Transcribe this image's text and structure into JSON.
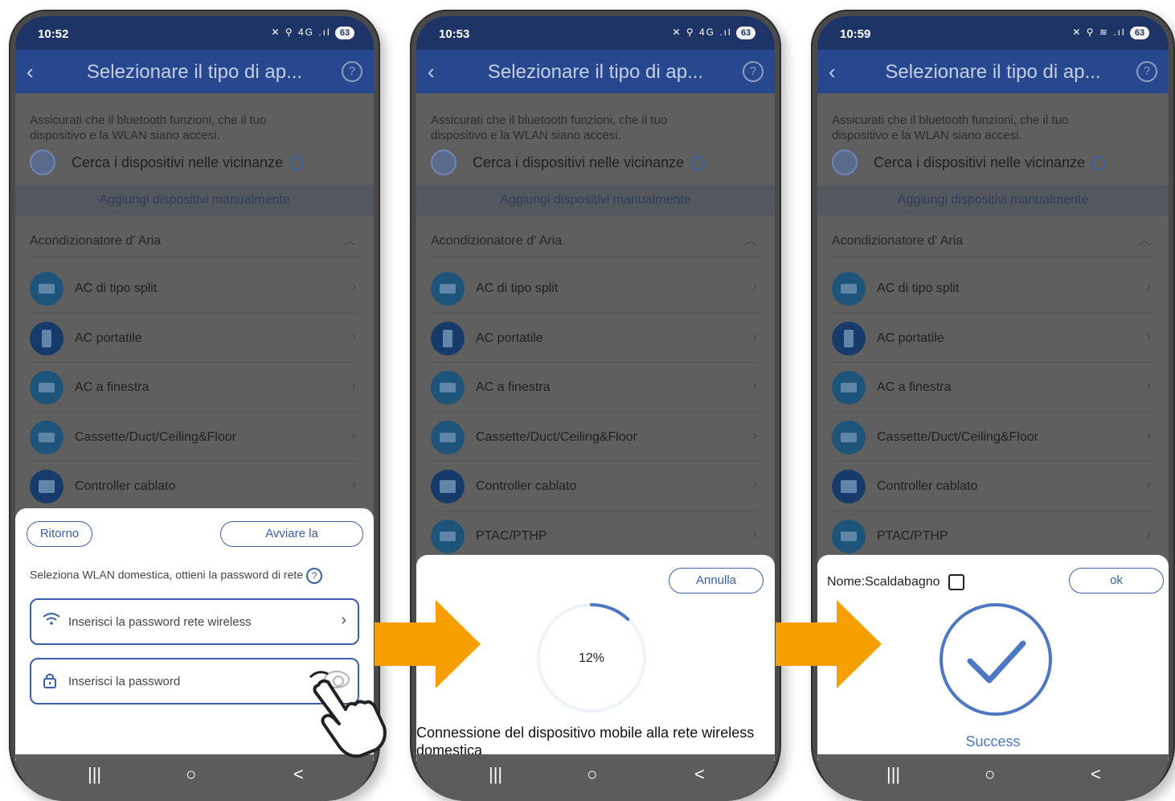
{
  "colors": {
    "accent": "#3b5fa8",
    "header": "#27488e",
    "statusbar": "#1e3467",
    "orange": "#f5a000",
    "success": "#4b77c5"
  },
  "common": {
    "title": "Selezionare il tipo di ap...",
    "info_text": "Assicurati che il bluetooth funzioni, che il tuo dispositivo e la WLAN siano accesi.",
    "search_label": "Cerca i dispositivi nelle vicinanze",
    "manual_label": "Aggiungi dispositivi manualmente",
    "section": "Acondizionatore d' Aria",
    "help_glyph": "?",
    "info_glyph": "!",
    "nav": {
      "recent": "|||",
      "home": "○",
      "back": "<"
    }
  },
  "screens": [
    {
      "time": "10:52",
      "status_icons": "✕ ⚲ 4G .ıl",
      "battery": "63",
      "items": [
        {
          "label": "AC di tipo split",
          "icon": "split-ac-icon"
        },
        {
          "label": "AC portatile",
          "icon": "portable-ac-icon"
        },
        {
          "label": "AC a finestra",
          "icon": "window-ac-icon"
        },
        {
          "label": "Cassette/Duct/Ceiling&Floor",
          "icon": "cassette-icon"
        },
        {
          "label": "Controller cablato",
          "icon": "controller-icon"
        }
      ],
      "sheet": {
        "back_button": "Ritorno",
        "start_button": "Avviare la",
        "wlan_hint": "Seleziona WLAN domestica, ottieni la password di rete",
        "wifi_placeholder": "Inserisci la password rete wireless",
        "password_placeholder": "Inserisci la password"
      }
    },
    {
      "time": "10:53",
      "status_icons": "✕ ⚲ 4G .ıl",
      "battery": "63",
      "items": [
        {
          "label": "AC di tipo split",
          "icon": "split-ac-icon"
        },
        {
          "label": "AC portatile",
          "icon": "portable-ac-icon"
        },
        {
          "label": "AC a finestra",
          "icon": "window-ac-icon"
        },
        {
          "label": "Cassette/Duct/Ceiling&Floor",
          "icon": "cassette-icon"
        },
        {
          "label": "Controller cablato",
          "icon": "controller-icon"
        },
        {
          "label": "PTAC/PTHP",
          "icon": "ptac-icon"
        }
      ],
      "sheet": {
        "cancel_button": "Annulla",
        "progress_percent": "12%",
        "progress_fraction": 0.12,
        "connecting_text": "Connessione del dispositivo mobile alla rete wireless domestica"
      }
    },
    {
      "time": "10:59",
      "status_icons": "✕ ⚲ ≋ .ıl",
      "battery": "63",
      "items": [
        {
          "label": "AC di tipo split",
          "icon": "split-ac-icon"
        },
        {
          "label": "AC portatile",
          "icon": "portable-ac-icon"
        },
        {
          "label": "AC a finestra",
          "icon": "window-ac-icon"
        },
        {
          "label": "Cassette/Duct/Ceiling&Floor",
          "icon": "cassette-icon"
        },
        {
          "label": "Controller cablato",
          "icon": "controller-icon"
        },
        {
          "label": "PTAC/PTHP",
          "icon": "ptac-icon"
        }
      ],
      "sheet": {
        "name_label": "Nome:Scaldabagno",
        "ok_button": "ok",
        "success_text": "Success"
      }
    }
  ]
}
